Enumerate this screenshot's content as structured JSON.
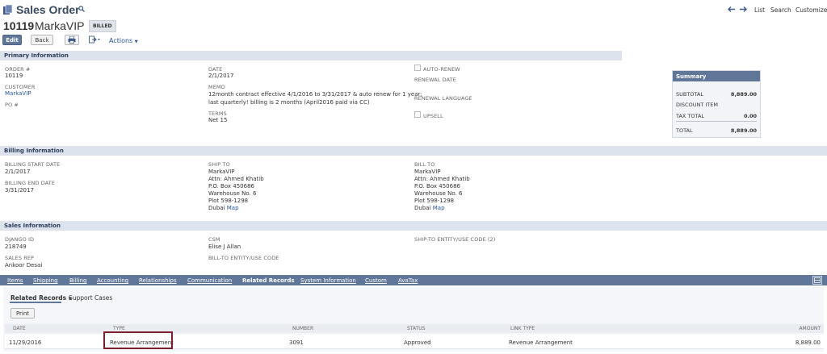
{
  "header": {
    "title": "Sales Order",
    "record_number": "10119",
    "record_name": "MarkaVIP",
    "status": "BILLED",
    "nav_list": "List",
    "nav_search": "Search",
    "nav_customize": "Customize"
  },
  "toolbar": {
    "edit": "Edit",
    "back": "Back",
    "actions": "Actions"
  },
  "primary": {
    "section": "Primary Information",
    "order_label": "ORDER #",
    "order_value": "10119",
    "customer_label": "CUSTOMER",
    "customer_value": "MarkaVIP",
    "po_label": "PO #",
    "date_label": "DATE",
    "date_value": "2/1/2017",
    "memo_label": "MEMO",
    "memo_line1": "12month contract effective 4/1/2016 to 3/31/2017 & auto renew for 1 year;",
    "memo_line2": "last quarterly! billing is 2 months (April2016 paid via CC)",
    "terms_label": "TERMS",
    "terms_value": "Net 15",
    "auto_renew_label": "AUTO-RENEW",
    "renewal_date_label": "RENEWAL DATE",
    "renewal_language_label": "RENEWAL LANGUAGE",
    "upsell_label": "UPSELL"
  },
  "summary": {
    "title": "Summary",
    "subtotal_label": "SUBTOTAL",
    "subtotal_value": "8,889.00",
    "discount_label": "DISCOUNT ITEM",
    "tax_label": "TAX TOTAL",
    "tax_value": "0.00",
    "total_label": "TOTAL",
    "total_value": "8,889.00"
  },
  "billing": {
    "section": "Billing Information",
    "start_label": "BILLING START DATE",
    "start_value": "2/1/2017",
    "end_label": "BILLING END DATE",
    "end_value": "3/31/2017",
    "ship_label": "SHIP TO",
    "bill_label": "BILL TO",
    "address": [
      "MarkaVIP",
      "Attn: Ahmed Khatib",
      "P.O. Box 450686",
      "Warehouse No. 6",
      "Plot 598-1298"
    ],
    "city": "Dubai",
    "map": "Map"
  },
  "sales": {
    "section": "Sales Information",
    "django_label": "DJANGO ID",
    "django_value": "218749",
    "rep_label": "SALES REP",
    "rep_value": "Ankoor Desai",
    "csm_label": "CSM",
    "csm_value": "Elise J Allan",
    "bill_entity_label": "BILL-TO ENTITY/USE CODE",
    "ship_entity_label": "SHIP-TO ENTITY/USE CODE (2)"
  },
  "tabs": [
    "Items",
    "Shipping",
    "Billing",
    "Accounting",
    "Relationships",
    "Communication",
    "Related Records",
    "System Information",
    "Custom",
    "AvaTax"
  ],
  "related": {
    "subtab_active": "Related Records",
    "subtab_other": "Support Cases",
    "print": "Print",
    "columns": [
      "DATE",
      "TYPE",
      "NUMBER",
      "STATUS",
      "LINK TYPE",
      "AMOUNT"
    ],
    "row": {
      "date": "11/29/2016",
      "type": "Revenue Arrangement",
      "number": "3091",
      "status": "Approved",
      "link_type": "Revenue Arrangement",
      "amount": "8,889.00"
    }
  }
}
